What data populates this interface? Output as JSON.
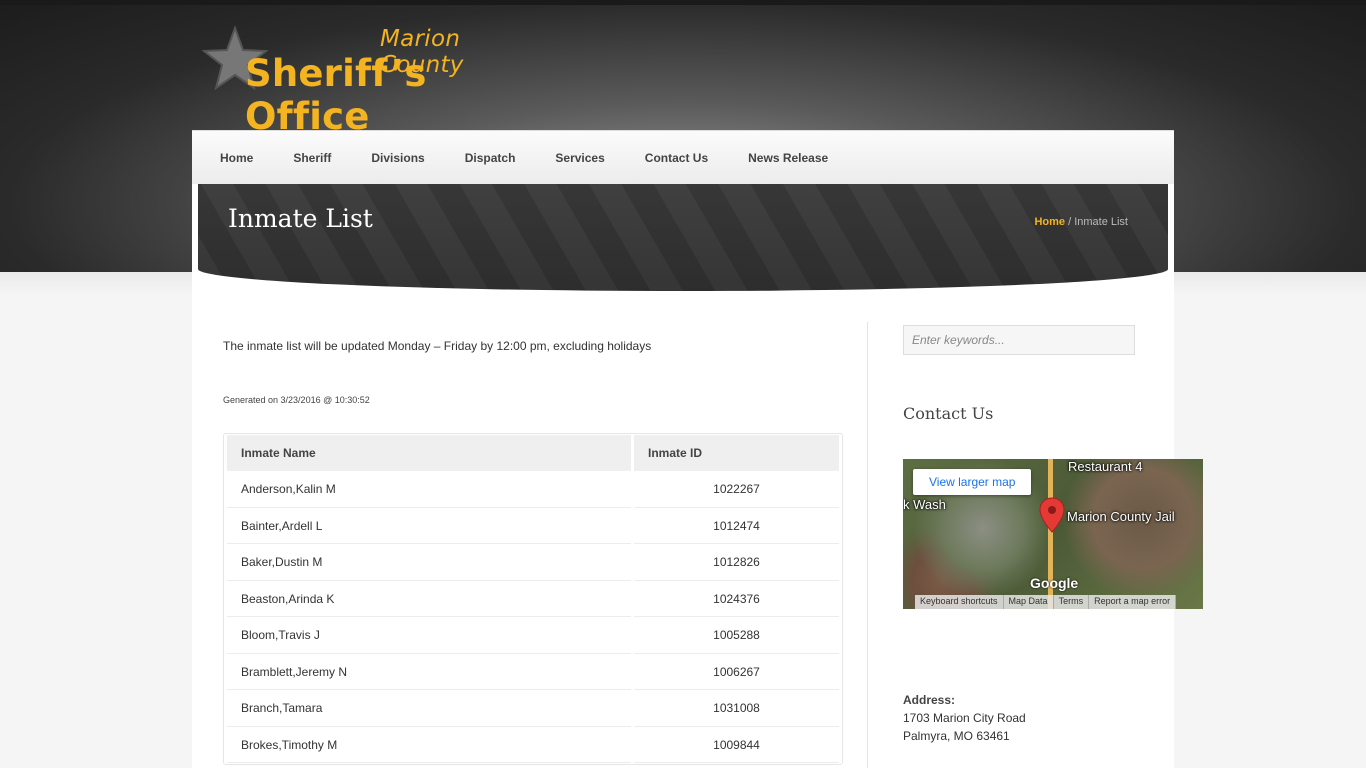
{
  "logo": {
    "county": "Marion County",
    "office": "Sheriff’s Office"
  },
  "nav": {
    "items": [
      "Home",
      "Sheriff",
      "Divisions",
      "Dispatch",
      "Services",
      "Contact Us",
      "News Release"
    ]
  },
  "page": {
    "title": "Inmate List",
    "breadcrumb_home": "Home",
    "breadcrumb_sep": " / ",
    "breadcrumb_current": "Inmate List"
  },
  "main": {
    "intro": "The inmate list will be updated Monday – Friday by 12:00 pm, excluding holidays",
    "generated": "Generated on 3/23/2016  @  10:30:52",
    "table": {
      "headers": [
        "Inmate Name",
        "Inmate ID"
      ],
      "rows": [
        [
          "Anderson,Kalin M",
          "1022267"
        ],
        [
          "Bainter,Ardell L",
          "1012474"
        ],
        [
          "Baker,Dustin M",
          "1012826"
        ],
        [
          "Beaston,Arinda K",
          "1024376"
        ],
        [
          "Bloom,Travis J",
          "1005288"
        ],
        [
          "Bramblett,Jeremy N",
          "1006267"
        ],
        [
          "Branch,Tamara",
          "1031008"
        ],
        [
          "Brokes,Timothy M",
          "1009844"
        ]
      ]
    }
  },
  "sidebar": {
    "search_placeholder": "Enter keywords...",
    "contact_heading": "Contact Us",
    "map": {
      "view_larger": "View larger map",
      "label_restaurant": "Restaurant 4",
      "label_wash": "k Wash",
      "label_jail": "Marion County Jail",
      "google": "Google",
      "footer": [
        "Keyboard shortcuts",
        "Map Data",
        "Terms",
        "Report a map error"
      ]
    },
    "address_label": "Address:",
    "address_line1": "1703 Marion City Road",
    "address_line2": "Palmyra, MO 63461"
  },
  "colors": {
    "accent": "#f4b320",
    "header_dark": "#2f2f2f"
  }
}
